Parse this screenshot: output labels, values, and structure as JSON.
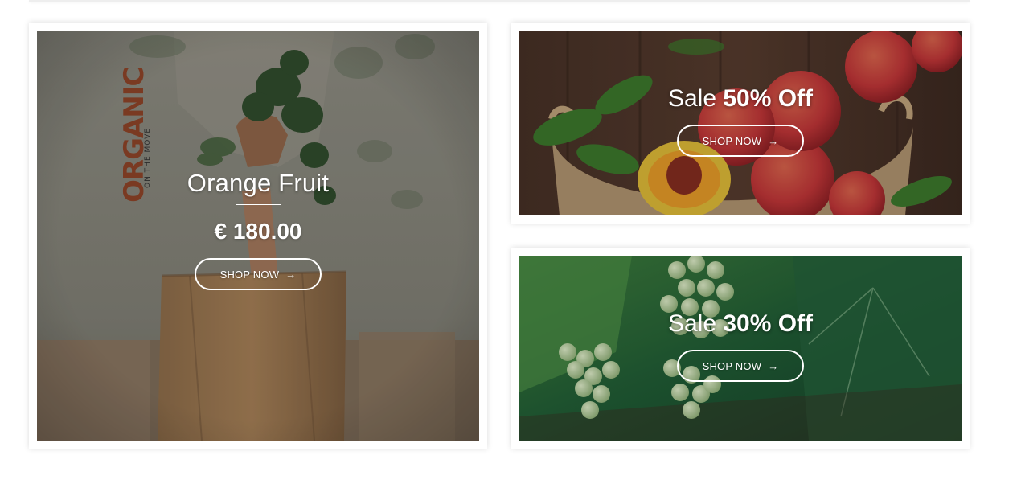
{
  "banners": {
    "left": {
      "logo_word": "ORGANIC",
      "logo_tagline": "ON THE MOVE",
      "title": "Orange Fruit",
      "price": "€ 180.00",
      "button": "SHOP NOW",
      "arrow": "→"
    },
    "top_right": {
      "sale_prefix": "Sale",
      "sale_amount": "50% Off",
      "button": "SHOP NOW",
      "arrow": "→"
    },
    "bottom_right": {
      "sale_prefix": "Sale",
      "sale_amount": "30% Off",
      "button": "SHOP NOW",
      "arrow": "→"
    }
  },
  "colors": {
    "button_border": "#ffffff",
    "text": "#ffffff"
  }
}
